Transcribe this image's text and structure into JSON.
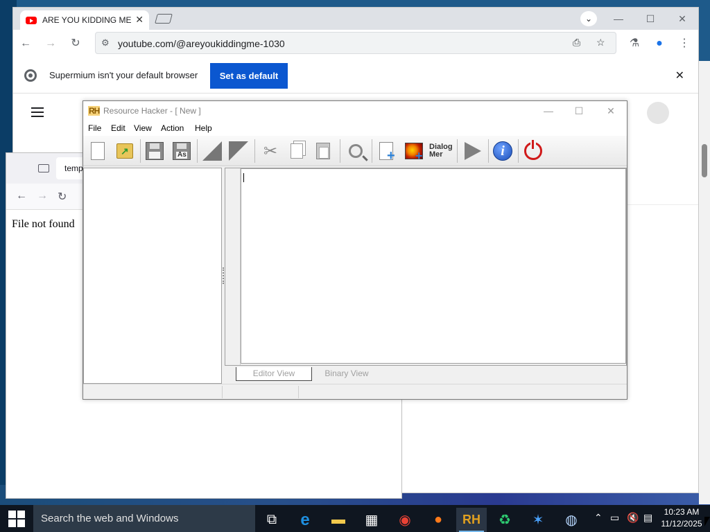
{
  "chrome": {
    "tab_title": "ARE YOU KIDDING ME",
    "tab_close": "✕",
    "url": "youtube.com/@areyoukiddingme-1030",
    "infobar_text": "Supermium isn't your default browser",
    "set_default_label": "Set as default",
    "infobar_close": "✕",
    "win_minimize": "—",
    "win_maximize": "☐",
    "win_close": "✕",
    "tab_search_icon": "chevron-down-icon"
  },
  "background_window": {
    "tab_label": "temp",
    "page_text": "File not found"
  },
  "resource_hacker": {
    "title": "Resource Hacker - [ New ]",
    "logo": "RH",
    "menus": [
      "File",
      "Edit",
      "View",
      "Action",
      "Help"
    ],
    "dialog_button_label_line1": "Dialog",
    "dialog_button_label_line2": "Mer",
    "tabs": [
      "Editor View",
      "Binary View"
    ],
    "active_tab": "Editor View",
    "win_minimize": "—",
    "win_maximize": "☐",
    "win_close": "✕"
  },
  "taskbar": {
    "search_placeholder": "Search the web and Windows",
    "time": "10:23 AM",
    "date": "11/12/2025",
    "rh_label": "RH"
  }
}
